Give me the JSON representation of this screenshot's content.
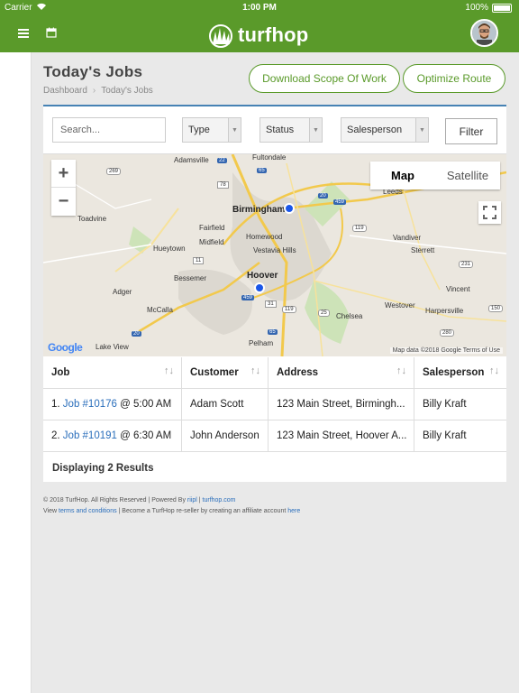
{
  "status_bar": {
    "carrier": "Carrier",
    "time": "1:00 PM",
    "battery": "100%"
  },
  "header": {
    "logo_text": "turfhop"
  },
  "page": {
    "title": "Today's Jobs",
    "breadcrumbs": [
      "Dashboard",
      "Today's Jobs"
    ],
    "buttons": {
      "download_scope": "Download Scope Of Work",
      "optimize_route": "Optimize Route"
    }
  },
  "filters": {
    "search_placeholder": "Search...",
    "type": "Type",
    "status": "Status",
    "salesperson": "Salesperson",
    "filter_button": "Filter"
  },
  "map": {
    "map_type_options": [
      "Map",
      "Satellite"
    ],
    "active_map_type": "Map",
    "zoom_in": "+",
    "zoom_out": "−",
    "google_logo": "Google",
    "attribution": "Map data ©2018 Google   Terms of Use",
    "place_labels": [
      "Adamsville",
      "Fultondale",
      "Leeds",
      "Toadvine",
      "Fairfield",
      "Birmingham",
      "Hueytown",
      "Midfield",
      "Homewood",
      "Vestavia Hills",
      "Vandiver",
      "Sterrett",
      "Bessemer",
      "Hoover",
      "Adger",
      "Vincent",
      "McCalla",
      "Westover",
      "Harpersville",
      "Chelsea",
      "Lake View",
      "Pelham"
    ],
    "road_labels": [
      "269",
      "22",
      "65",
      "78",
      "20",
      "459",
      "119",
      "11",
      "231",
      "150",
      "459",
      "31",
      "119",
      "25",
      "20",
      "65",
      "280"
    ]
  },
  "table": {
    "headers": [
      "Job",
      "Customer",
      "Address",
      "Salesperson"
    ],
    "rows": [
      {
        "num": "1.",
        "job": "Job #10176",
        "time": "@ 5:00 AM",
        "customer": "Adam Scott",
        "address": "123 Main Street, Birmingh...",
        "salesperson": "Billy Kraft"
      },
      {
        "num": "2.",
        "job": "Job #10191",
        "time": "@ 6:30 AM",
        "customer": "John Anderson",
        "address": "123 Main Street, Hoover A...",
        "salesperson": "Billy Kraft"
      }
    ],
    "summary": "Displaying 2 Results"
  },
  "footer": {
    "copyright": "© 2018 TurfHop. All Rights Reserved | Powered By",
    "powered_link": "riipl",
    "site_sep": "|",
    "site_link": "turfhop.com",
    "terms_prefix": "View",
    "terms_link": "terms and conditions",
    "terms_middle": "| Become a TurfHop re-seller by creating an affiliate account",
    "here_link": "here"
  },
  "colors": {
    "brand_green": "#5a9a2a",
    "link_blue": "#2a6ebb",
    "marker_blue": "#1a56e8"
  }
}
